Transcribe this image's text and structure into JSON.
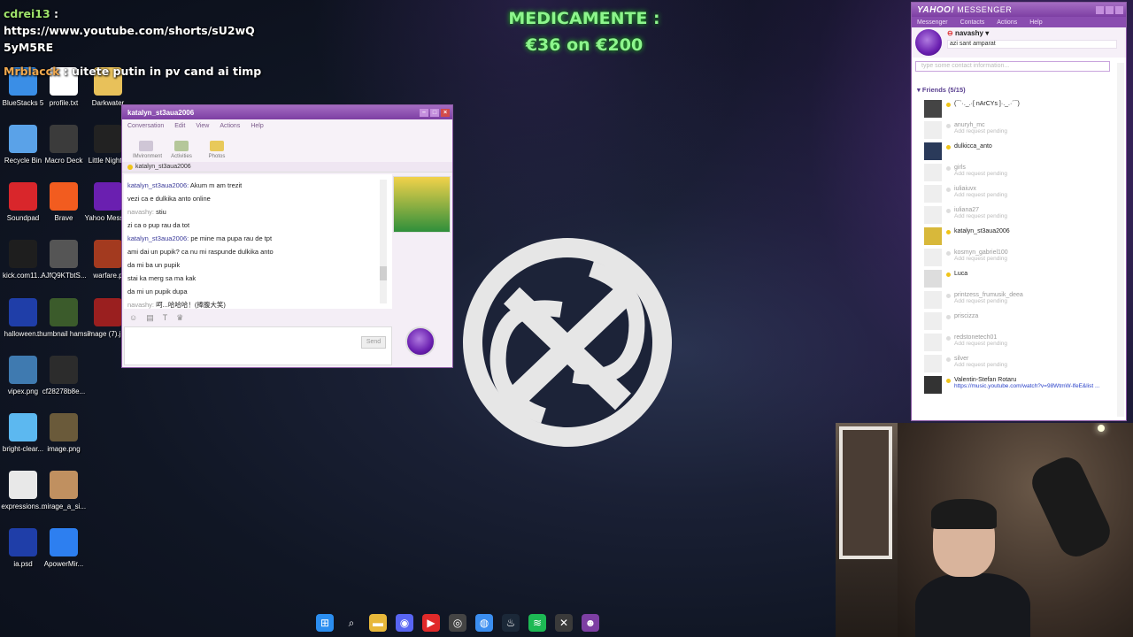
{
  "overlay": {
    "donation_line1": "MEDICAMENTE :",
    "donation_line2": "€36 on €200"
  },
  "stream_chat": [
    {
      "user": "cdrei13",
      "sep": " :",
      "text": ""
    },
    {
      "user": "",
      "sep": "",
      "text": "https://www.youtube.com/shorts/sU2wQ5yM5RE"
    },
    {
      "user": "Mrblacck",
      "sep": " :",
      "text": " uitete putin in pv cand ai timp"
    }
  ],
  "desktop_icons": [
    {
      "label": "BlueStacks 5",
      "icon": "bluestacks-icon",
      "color": "#3a8ee6"
    },
    {
      "label": "profile.txt",
      "icon": "text-file-icon",
      "color": "#ffffff"
    },
    {
      "label": "Darkwater",
      "icon": "folder-icon",
      "color": "#e8c15a"
    },
    {
      "label": "Recycle Bin",
      "icon": "recycle-bin-icon",
      "color": "#5aa2e8"
    },
    {
      "label": "Macro Deck",
      "icon": "macro-deck-icon",
      "color": "#3b3b3b"
    },
    {
      "label": "Little Nightm",
      "icon": "game-icon",
      "color": "#222222"
    },
    {
      "label": "Soundpad",
      "icon": "soundpad-icon",
      "color": "#d9262b"
    },
    {
      "label": "Brave",
      "icon": "brave-icon",
      "color": "#f25c1f"
    },
    {
      "label": "Yahoo Messen",
      "icon": "yahoo-icon",
      "color": "#6a1fb0"
    },
    {
      "label": "kick.com11...",
      "icon": "image-file-icon",
      "color": "#1e1e1e"
    },
    {
      "label": "AJfQ9KTbtS...",
      "icon": "image-file-icon",
      "color": "#555555"
    },
    {
      "label": "warfare.p",
      "icon": "image-file-icon",
      "color": "#a33a1f"
    },
    {
      "label": "halloween...",
      "icon": "psd-file-icon",
      "color": "#1f3ea8"
    },
    {
      "label": "thumbnail hamsik.png",
      "icon": "image-file-icon",
      "color": "#3b5b2b"
    },
    {
      "label": "image (7).jpg",
      "icon": "image-file-icon",
      "color": "#9a1f1f"
    },
    {
      "label": "vipex.png",
      "icon": "image-file-icon",
      "color": "#3f7ab0"
    },
    {
      "label": "cf28278b8e...",
      "icon": "image-file-icon",
      "color": "#2c2c2c"
    },
    {
      "label": "bright-clear...",
      "icon": "image-file-icon",
      "color": "#5cb8f0"
    },
    {
      "label": "image.png",
      "icon": "image-file-icon",
      "color": "#6a5a3a"
    },
    {
      "label": "expressions...",
      "icon": "image-file-icon",
      "color": "#e8e8e8"
    },
    {
      "label": "mirage_a_si...",
      "icon": "image-file-icon",
      "color": "#c09060"
    },
    {
      "label": "ia.psd",
      "icon": "psd-file-icon",
      "color": "#1f3ea8"
    },
    {
      "label": "ApowerMir...",
      "icon": "apowermirror-icon",
      "color": "#2d7ff0"
    }
  ],
  "conversation": {
    "title": "katalyn_st3aua2006",
    "menu": [
      "Conversation",
      "Edit",
      "View",
      "Actions",
      "Help"
    ],
    "tools": [
      "IMvironment",
      "Activities",
      "Photos"
    ],
    "tab": "katalyn_st3aua2006",
    "messages": [
      {
        "who": "katalyn_st3aua2006:",
        "me": false,
        "text": " Akum m am trezit"
      },
      {
        "who": "",
        "me": false,
        "text": "vezi ca e dulkika anto online"
      },
      {
        "who": "navashy:",
        "me": true,
        "text": " stiu"
      },
      {
        "who": "",
        "me": true,
        "text": "zi ca o pup rau da tot"
      },
      {
        "who": "katalyn_st3aua2006:",
        "me": false,
        "text": " pe mine ma pupa rau de tpt"
      },
      {
        "who": "",
        "me": false,
        "text": "ami dai un pupik? ca nu mi raspunde dulkika anto"
      },
      {
        "who": "",
        "me": false,
        "text": "da mi ba un pupik"
      },
      {
        "who": "",
        "me": false,
        "text": "stai ka merg sa ma kak"
      },
      {
        "who": "",
        "me": false,
        "text": "da mi un pupik dupa"
      },
      {
        "who": "navashy:",
        "me": true,
        "text": " 呵...哈哈哈！(捧腹大笑)"
      }
    ],
    "send_label": "Send"
  },
  "messenger": {
    "title_brand": "YAHOO!",
    "title_text": "MESSENGER",
    "menu": [
      "Messenger",
      "Contacts",
      "Actions",
      "Help"
    ],
    "profile_name": "navashy",
    "status": "azi sant amparat",
    "search_placeholder": "type some contact information...",
    "friends_header": "Friends (5/15)",
    "contacts": [
      {
        "name": "(¯`·._.·[ nArCYs ]·._.·´¯)",
        "status": "",
        "online": true,
        "has_avatar": true,
        "avatar_color": "#444444"
      },
      {
        "name": "anuryh_mc",
        "status": "Add request pending",
        "online": false,
        "has_avatar": false,
        "avatar_color": "#eeeeee"
      },
      {
        "name": "dulkicca_anto",
        "status": "",
        "online": true,
        "has_avatar": true,
        "avatar_color": "#2a3a5a"
      },
      {
        "name": "girls",
        "status": "Add request pending",
        "online": false,
        "has_avatar": false,
        "avatar_color": "#eeeeee"
      },
      {
        "name": "iuliaiuvx",
        "status": "Add request pending",
        "online": false,
        "has_avatar": false,
        "avatar_color": "#eeeeee"
      },
      {
        "name": "iuliana27",
        "status": "Add request pending",
        "online": false,
        "has_avatar": false,
        "avatar_color": "#eeeeee"
      },
      {
        "name": "katalyn_st3aua2006",
        "status": "",
        "online": true,
        "has_avatar": true,
        "avatar_color": "#d8b83a"
      },
      {
        "name": "kosmyn_gabriel100",
        "status": "Add request pending",
        "online": false,
        "has_avatar": false,
        "avatar_color": "#eeeeee"
      },
      {
        "name": "Luca",
        "status": "",
        "online": true,
        "has_avatar": true,
        "avatar_color": "#dddddd"
      },
      {
        "name": "printzess_frumusik_deea",
        "status": "Add request pending",
        "online": false,
        "has_avatar": false,
        "avatar_color": "#eeeeee"
      },
      {
        "name": "priscizza",
        "status": "",
        "online": false,
        "has_avatar": false,
        "avatar_color": "#eeeeee"
      },
      {
        "name": "redstonetech01",
        "status": "Add request pending",
        "online": false,
        "has_avatar": false,
        "avatar_color": "#eeeeee"
      },
      {
        "name": "silver",
        "status": "Add request pending",
        "online": false,
        "has_avatar": false,
        "avatar_color": "#eeeeee"
      },
      {
        "name": "Valentin-Stefan Rotaru",
        "status": "https://music.youtube.com/watch?v=98WtmW-lfeE&list ...",
        "online": true,
        "has_avatar": true,
        "avatar_color": "#333333",
        "link": true
      }
    ]
  },
  "taskbar": [
    {
      "icon": "windows-start-icon",
      "color": "#2b8ef0",
      "glyph": "⊞"
    },
    {
      "icon": "search-icon",
      "color": "transparent",
      "glyph": "⌕"
    },
    {
      "icon": "file-explorer-icon",
      "color": "#e8b83a",
      "glyph": "▬"
    },
    {
      "icon": "discord-icon",
      "color": "#5865f2",
      "glyph": "◉"
    },
    {
      "icon": "youtube-icon",
      "color": "#e02a2a",
      "glyph": "▶"
    },
    {
      "icon": "obs-icon",
      "color": "#444444",
      "glyph": "◎"
    },
    {
      "icon": "chrome-icon",
      "color": "#3b8ef0",
      "glyph": "◍"
    },
    {
      "icon": "steam-icon",
      "color": "#1b2838",
      "glyph": "♨"
    },
    {
      "icon": "spotify-icon",
      "color": "#1db954",
      "glyph": "≋"
    },
    {
      "icon": "xbox-icon",
      "color": "#3a3a3a",
      "glyph": "✕"
    },
    {
      "icon": "yahoo-messenger-icon",
      "color": "#7d3fa3",
      "glyph": "☻"
    }
  ]
}
